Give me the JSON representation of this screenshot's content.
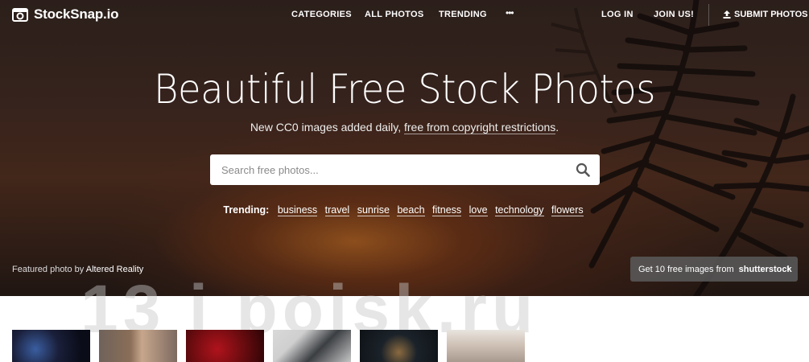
{
  "brand": {
    "name": "StockSnap.io",
    "icon": "camera-icon"
  },
  "nav": {
    "categories": "CATEGORIES",
    "all_photos": "ALL PHOTOS",
    "trending": "TRENDING",
    "more": "•••",
    "login": "LOG IN",
    "join": "JOIN US!",
    "submit": "SUBMIT PHOTOS"
  },
  "hero": {
    "title": "Beautiful Free Stock Photos",
    "subtitle_prefix": "New CC0 images added daily, ",
    "subtitle_link": "free from copyright restrictions",
    "subtitle_suffix": "."
  },
  "search": {
    "placeholder": "Search free photos...",
    "icon": "search-icon"
  },
  "trending": {
    "label": "Trending:",
    "tags": [
      "business",
      "travel",
      "sunrise",
      "beach",
      "fitness",
      "love",
      "technology",
      "flowers"
    ]
  },
  "credit": {
    "prefix": "Featured photo by ",
    "author": "Altered Reality"
  },
  "promo": {
    "label": "Get 10 free images from",
    "brand": "shutterstock",
    "chevron": "›"
  },
  "watermark": "13 i poisk.ru",
  "thumbnails": [
    "photo-1",
    "photo-2",
    "photo-3",
    "photo-4",
    "photo-5",
    "photo-6"
  ]
}
